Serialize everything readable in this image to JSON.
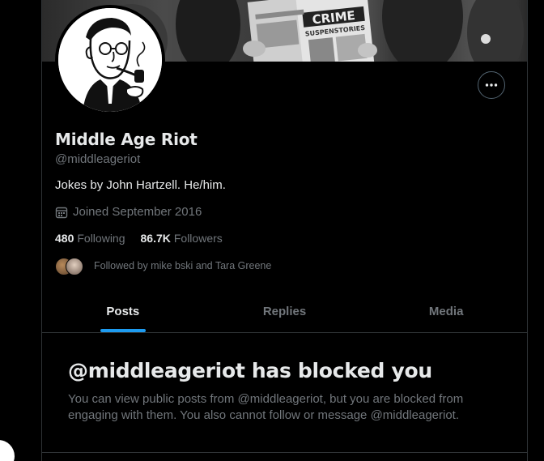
{
  "profile": {
    "name": "Middle Age Riot",
    "handle": "@middleageriot",
    "bio": "Jokes by John Hartzell. He/him.",
    "joined": "Joined September 2016",
    "following_count": "480",
    "following_label": "Following",
    "followers_count": "86.7K",
    "followers_label": "Followers",
    "followed_by": "Followed by mike bski and Tara Greene"
  },
  "banner": {
    "comic_title": "CRIME",
    "comic_subtitle": "SUSPENSTORIES"
  },
  "tabs": [
    {
      "label": "Posts",
      "active": true
    },
    {
      "label": "Replies",
      "active": false
    },
    {
      "label": "Media",
      "active": false
    }
  ],
  "blocked": {
    "title": "@middleageriot has blocked you",
    "message": "You can view public posts from @middleageriot, but you are blocked from engaging with them. You also cannot follow or message @middleageriot."
  },
  "colors": {
    "background": "#000000",
    "text_primary": "#e7e9ea",
    "text_secondary": "#71767b",
    "accent": "#1d9bf0",
    "border": "#2f3336"
  },
  "icons": {
    "more": "more-horizontal-icon",
    "calendar": "calendar-icon"
  }
}
